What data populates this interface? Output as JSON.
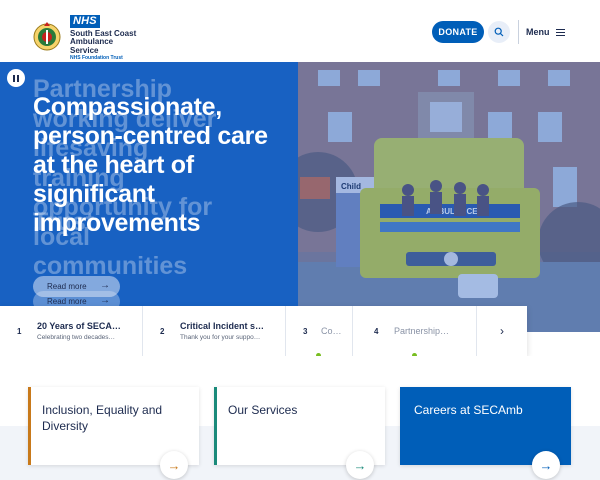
{
  "header": {
    "nhs_badge": "NHS",
    "org_name": "South East Coast Ambulance Service",
    "org_sub": "NHS Foundation Trust",
    "donate_label": "DONATE",
    "menu_label": "Menu"
  },
  "hero": {
    "headline": "Compassionate, person-centred care at the heart of significant improvements",
    "ghost_lines": [
      "Partnership",
      "working deliver",
      "lifesaving",
      "training",
      "opportunity for",
      "Trust",
      "local",
      "communities"
    ],
    "read_more_front": "Read more",
    "read_more_back": "Read more",
    "photo_signs": [
      "AMBULANCE",
      "Child"
    ]
  },
  "carousel": {
    "slides": [
      {
        "num": "1",
        "title": "20 Years of SECA…",
        "subtitle": "Celebrating two decades…"
      },
      {
        "num": "2",
        "title": "Critical Incident s…",
        "subtitle": "Thank you for your suppo…"
      },
      {
        "num": "3",
        "title": "Co…",
        "subtitle": ""
      },
      {
        "num": "4",
        "title": "Partnership…",
        "subtitle": ""
      }
    ]
  },
  "cards": [
    {
      "title": "Inclusion, Equality and Diversity",
      "accent": "#c8791a"
    },
    {
      "title": "Our Services",
      "accent": "#1a8a7a"
    },
    {
      "title": "Careers at SECAmb",
      "accent": "#005eb8"
    }
  ],
  "colors": {
    "brand_blue": "#005eb8",
    "hero_blue": "#1861c2",
    "dot_green": "#78be20",
    "navy": "#1d2b4f"
  }
}
